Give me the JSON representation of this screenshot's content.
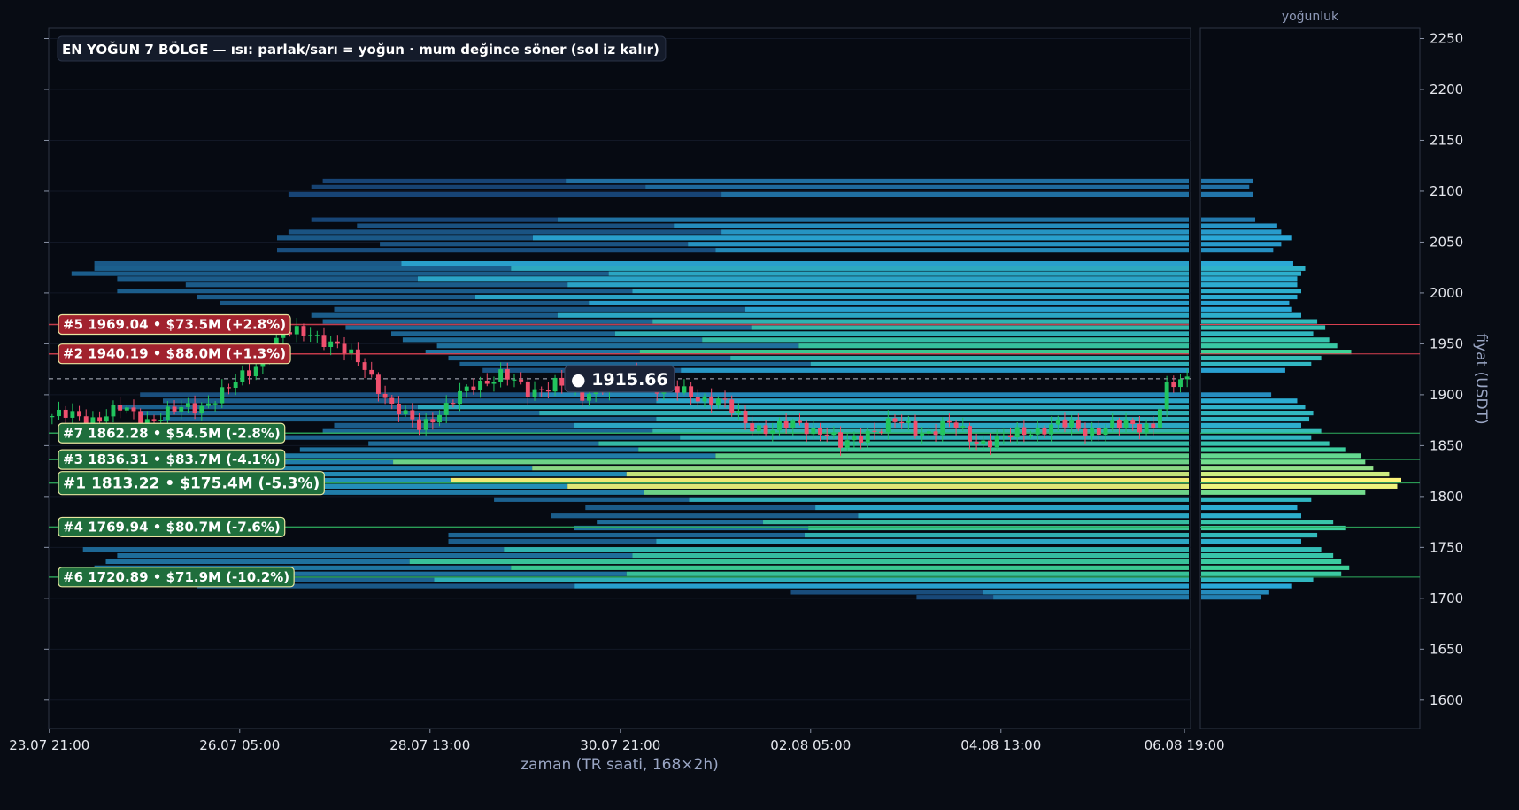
{
  "chart_data": {
    "type": "heatmap",
    "title": "EN YOĞUN 7 BÖLGE — ısı: parlak/sarı = yoğun · mum değince söner (sol iz kalır)",
    "xlabel": "zaman (TR saati, 168×2h)",
    "ylabel": "fiyat (USDT)",
    "side_panel_title": "yoğunluk",
    "ylim": [
      1572,
      2260
    ],
    "y_ticks": [
      1600,
      1650,
      1700,
      1750,
      1800,
      1850,
      1900,
      1950,
      2000,
      2050,
      2100,
      2150,
      2200,
      2250
    ],
    "x_tick_labels": [
      "23.07 21:00",
      "26.07 05:00",
      "28.07 13:00",
      "30.07 21:00",
      "02.08 05:00",
      "04.08 13:00",
      "06.08 19:00"
    ],
    "x_tick_index": [
      0,
      28,
      56,
      84,
      112,
      140,
      167
    ],
    "bar_count": 168,
    "current_price": {
      "value": 1915.66,
      "label": "● 1915.66"
    },
    "zones": [
      {
        "rank": 5,
        "price": 1969.04,
        "label": "#5  1969.04  •  $73.5M  (+2.8%)",
        "side": "above"
      },
      {
        "rank": 2,
        "price": 1940.19,
        "label": "#2  1940.19  •  $88.0M  (+1.3%)",
        "side": "above"
      },
      {
        "rank": 7,
        "price": 1862.28,
        "label": "#7  1862.28  •  $54.5M  (-2.8%)",
        "side": "below"
      },
      {
        "rank": 3,
        "price": 1836.31,
        "label": "#3  1836.31  •  $83.7M  (-4.1%)",
        "side": "below"
      },
      {
        "rank": 1,
        "price": 1813.22,
        "label": "#1  1813.22  •  $175.4M  (-5.3%)",
        "side": "below"
      },
      {
        "rank": 4,
        "price": 1769.94,
        "label": "#4  1769.94  •  $80.7M  (-7.6%)",
        "side": "below"
      },
      {
        "rank": 6,
        "price": 1720.89,
        "label": "#6  1720.89  •  $71.9M  (-10.2%)",
        "side": "below"
      }
    ],
    "price_path": [
      [
        0,
        1879
      ],
      [
        6,
        1877
      ],
      [
        10,
        1885
      ],
      [
        14,
        1876
      ],
      [
        18,
        1883
      ],
      [
        22,
        1890
      ],
      [
        26,
        1905
      ],
      [
        30,
        1930
      ],
      [
        34,
        1958
      ],
      [
        38,
        1963
      ],
      [
        42,
        1945
      ],
      [
        46,
        1930
      ],
      [
        50,
        1885
      ],
      [
        54,
        1872
      ],
      [
        58,
        1885
      ],
      [
        62,
        1912
      ],
      [
        66,
        1918
      ],
      [
        70,
        1905
      ],
      [
        74,
        1910
      ],
      [
        78,
        1900
      ],
      [
        82,
        1912
      ],
      [
        86,
        1918
      ],
      [
        90,
        1905
      ],
      [
        94,
        1900
      ],
      [
        98,
        1895
      ],
      [
        102,
        1872
      ],
      [
        106,
        1866
      ],
      [
        110,
        1870
      ],
      [
        114,
        1864
      ],
      [
        116,
        1848
      ],
      [
        118,
        1855
      ],
      [
        120,
        1865
      ],
      [
        124,
        1872
      ],
      [
        128,
        1864
      ],
      [
        132,
        1870
      ],
      [
        136,
        1855
      ],
      [
        140,
        1856
      ],
      [
        144,
        1866
      ],
      [
        148,
        1870
      ],
      [
        152,
        1866
      ],
      [
        156,
        1868
      ],
      [
        160,
        1870
      ],
      [
        162,
        1872
      ],
      [
        164,
        1905
      ],
      [
        167,
        1914
      ]
    ],
    "heat_bands": [
      {
        "p": 2110,
        "d": 0.26,
        "s": 0.24
      },
      {
        "p": 2104,
        "d": 0.24,
        "s": 0.23
      },
      {
        "p": 2097,
        "d": 0.26,
        "s": 0.21
      },
      {
        "p": 2072,
        "d": 0.27,
        "s": 0.23
      },
      {
        "p": 2066,
        "d": 0.38,
        "s": 0.27
      },
      {
        "p": 2060,
        "d": 0.4,
        "s": 0.21
      },
      {
        "p": 2054,
        "d": 0.45,
        "s": 0.2
      },
      {
        "p": 2048,
        "d": 0.4,
        "s": 0.29
      },
      {
        "p": 2042,
        "d": 0.36,
        "s": 0.2
      },
      {
        "p": 2029,
        "d": 0.46,
        "s": 0.04
      },
      {
        "p": 2024,
        "d": 0.52,
        "s": 0.04
      },
      {
        "p": 2019,
        "d": 0.5,
        "s": 0.02
      },
      {
        "p": 2014,
        "d": 0.48,
        "s": 0.06
      },
      {
        "p": 2008,
        "d": 0.48,
        "s": 0.12
      },
      {
        "p": 2002,
        "d": 0.5,
        "s": 0.06
      },
      {
        "p": 1996,
        "d": 0.48,
        "s": 0.13
      },
      {
        "p": 1990,
        "d": 0.44,
        "s": 0.15
      },
      {
        "p": 1984,
        "d": 0.45,
        "s": 0.25
      },
      {
        "p": 1978,
        "d": 0.5,
        "s": 0.23
      },
      {
        "p": 1972,
        "d": 0.58,
        "s": 0.24
      },
      {
        "p": 1966,
        "d": 0.62,
        "s": 0.26
      },
      {
        "p": 1960,
        "d": 0.56,
        "s": 0.3
      },
      {
        "p": 1954,
        "d": 0.64,
        "s": 0.31
      },
      {
        "p": 1948,
        "d": 0.68,
        "s": 0.34
      },
      {
        "p": 1942,
        "d": 0.75,
        "s": 0.33
      },
      {
        "p": 1936,
        "d": 0.6,
        "s": 0.35
      },
      {
        "p": 1930,
        "d": 0.55,
        "s": 0.36
      },
      {
        "p": 1924,
        "d": 0.42,
        "s": 0.38
      },
      {
        "p": 1900,
        "d": 0.35,
        "s": 0.08
      },
      {
        "p": 1894,
        "d": 0.48,
        "s": 0.1
      },
      {
        "p": 1888,
        "d": 0.52,
        "s": 0.06
      },
      {
        "p": 1882,
        "d": 0.56,
        "s": 0.08
      },
      {
        "p": 1876,
        "d": 0.54,
        "s": 0.1
      },
      {
        "p": 1870,
        "d": 0.5,
        "s": 0.25
      },
      {
        "p": 1864,
        "d": 0.6,
        "s": 0.24
      },
      {
        "p": 1858,
        "d": 0.55,
        "s": 0.14
      },
      {
        "p": 1852,
        "d": 0.64,
        "s": 0.28
      },
      {
        "p": 1846,
        "d": 0.72,
        "s": 0.22
      },
      {
        "p": 1840,
        "d": 0.8,
        "s": 0.2
      },
      {
        "p": 1834,
        "d": 0.82,
        "s": 0.03
      },
      {
        "p": 1828,
        "d": 0.86,
        "s": 0.07
      },
      {
        "p": 1822,
        "d": 0.94,
        "s": 0.05
      },
      {
        "p": 1816,
        "d": 1.0,
        "s": 0.1
      },
      {
        "p": 1810,
        "d": 0.98,
        "s": 0.12
      },
      {
        "p": 1804,
        "d": 0.82,
        "s": 0.08
      },
      {
        "p": 1797,
        "d": 0.55,
        "s": 0.39
      },
      {
        "p": 1789,
        "d": 0.48,
        "s": 0.47
      },
      {
        "p": 1781,
        "d": 0.5,
        "s": 0.44
      },
      {
        "p": 1775,
        "d": 0.66,
        "s": 0.48
      },
      {
        "p": 1769,
        "d": 0.72,
        "s": 0.46
      },
      {
        "p": 1762,
        "d": 0.58,
        "s": 0.35
      },
      {
        "p": 1756,
        "d": 0.5,
        "s": 0.35
      },
      {
        "p": 1748,
        "d": 0.6,
        "s": 0.03
      },
      {
        "p": 1742,
        "d": 0.66,
        "s": 0.06
      },
      {
        "p": 1736,
        "d": 0.7,
        "s": 0.05
      },
      {
        "p": 1730,
        "d": 0.74,
        "s": 0.04
      },
      {
        "p": 1724,
        "d": 0.7,
        "s": 0.05
      },
      {
        "p": 1718,
        "d": 0.56,
        "s": 0.08
      },
      {
        "p": 1712,
        "d": 0.45,
        "s": 0.13
      },
      {
        "p": 1706,
        "d": 0.34,
        "s": 0.65
      },
      {
        "p": 1701,
        "d": 0.3,
        "s": 0.76
      }
    ],
    "colors": {
      "background": "#080c14",
      "axis": "#3a4150",
      "up_candle": "#22c55e",
      "down_candle": "#f0506e",
      "zone_above": "#a1222e",
      "zone_below": "#1f6e3c",
      "zone_border": "#e8e6a0",
      "heat_low": "#16306a",
      "heat_mid": "#2aa8d8",
      "heat_high": "#fdf57a"
    }
  }
}
